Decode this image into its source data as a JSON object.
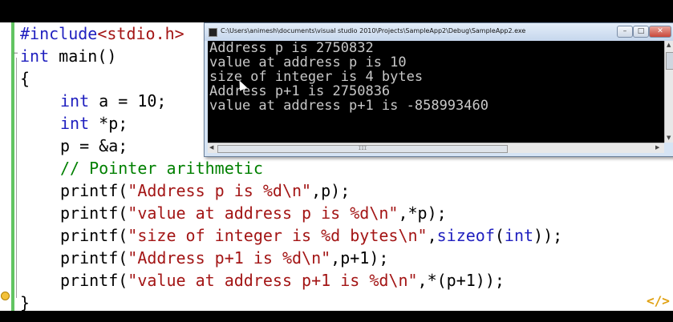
{
  "console": {
    "title": "C:\\Users\\animesh\\documents\\visual studio 2010\\Projects\\SampleApp2\\Debug\\SampleApp2.exe",
    "buttons": {
      "minimize": "–",
      "maximize": "□",
      "close": "✕"
    },
    "output": [
      "Address p is 2750832",
      "value at address p is 10",
      "size of integer is 4 bytes",
      "Address p+1 is 2750836",
      "value at address p+1 is -858993460"
    ],
    "scroll_thumb_label": "III"
  },
  "editor": {
    "lines": {
      "l1_pp": "#include",
      "l1_inc": "<stdio.h>",
      "l2_kw": "int",
      "l2_rest": " main()",
      "l3": "{",
      "l4_kw": "int",
      "l4_rest": " a = 10;",
      "l5_kw": "int",
      "l5_rest": " *p;",
      "l6": "p = &a;",
      "l7_cmt": "// Pointer arithmetic",
      "l8_a": "printf(",
      "l8_str": "\"Address p is %d\\n\"",
      "l8_b": ",p);",
      "l9_a": "printf(",
      "l9_str": "\"value at address p is %d\\n\"",
      "l9_b": ",*p);",
      "l10_a": "printf(",
      "l10_str": "\"size of integer is %d bytes\\n\"",
      "l10_b": ",",
      "l10_kw1": "sizeof",
      "l10_c": "(",
      "l10_kw2": "int",
      "l10_d": "));",
      "l11_a": "printf(",
      "l11_str": "\"Address p+1 is %d\\n\"",
      "l11_b": ",p+1);",
      "l12_a": "printf(",
      "l12_str": "\"value at address p+1 is %d\\n\"",
      "l12_b": ",*(p+1));",
      "l13": "}"
    }
  },
  "logo": {
    "text": "</>"
  }
}
